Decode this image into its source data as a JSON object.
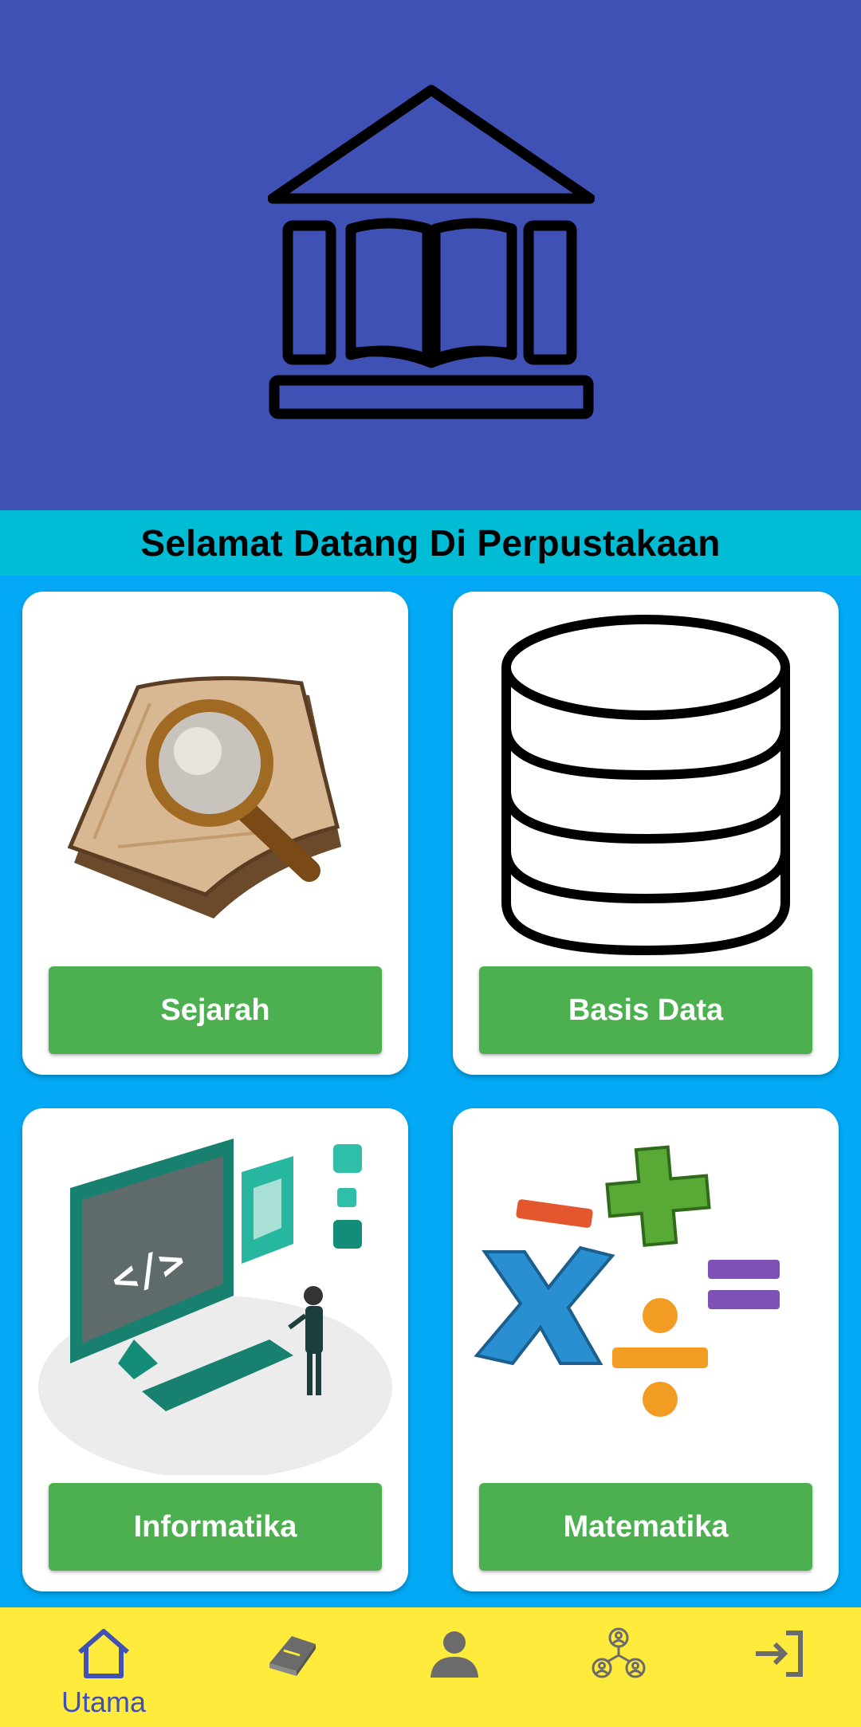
{
  "header": {
    "logo_icon": "library-icon",
    "welcome_text": "Selamat Datang Di Perpustakaan"
  },
  "categories": [
    {
      "label": "Sejarah",
      "icon": "magnifier-scroll-icon"
    },
    {
      "label": "Basis Data",
      "icon": "database-icon"
    },
    {
      "label": "Informatika",
      "icon": "computer-code-icon"
    },
    {
      "label": "Matematika",
      "icon": "math-operators-icon"
    }
  ],
  "bottom_nav": {
    "items": [
      {
        "label": "Utama",
        "icon": "home-icon",
        "active": true
      },
      {
        "label": "",
        "icon": "book-icon",
        "active": false
      },
      {
        "label": "",
        "icon": "person-icon",
        "active": false
      },
      {
        "label": "",
        "icon": "group-icon",
        "active": false
      },
      {
        "label": "",
        "icon": "logout-icon",
        "active": false
      }
    ]
  },
  "colors": {
    "header_bg": "#3f51b5",
    "welcome_bg": "#00bcd4",
    "content_bg": "#03a9f4",
    "button_bg": "#4caf50",
    "nav_bg": "#ffeb3b",
    "nav_active": "#3f51b5"
  }
}
